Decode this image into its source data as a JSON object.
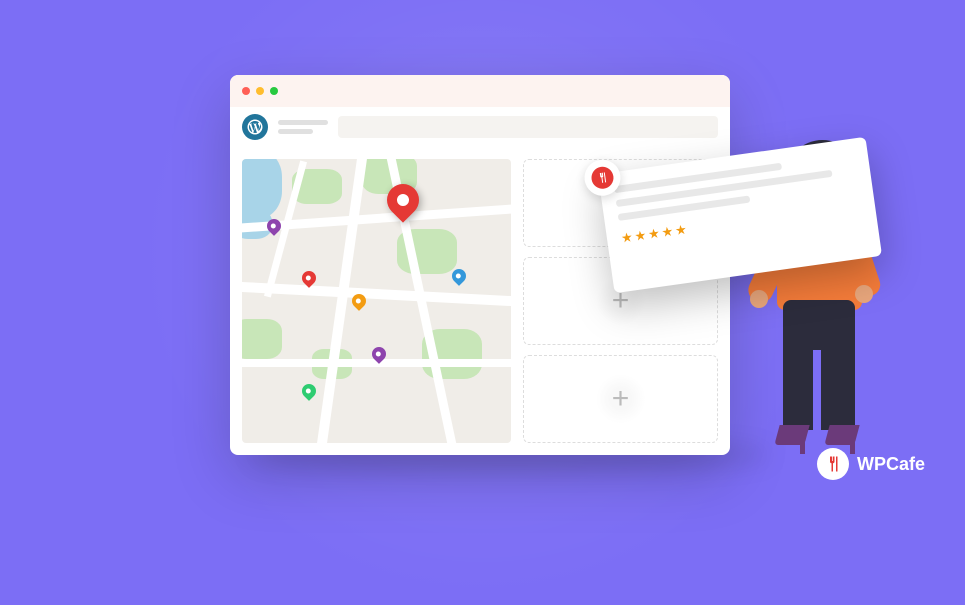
{
  "browser": {
    "dots": [
      "red",
      "yellow",
      "green"
    ]
  },
  "slots": {
    "plus": "+"
  },
  "card": {
    "stars": 5
  },
  "logo": {
    "text": "WPCafe"
  }
}
